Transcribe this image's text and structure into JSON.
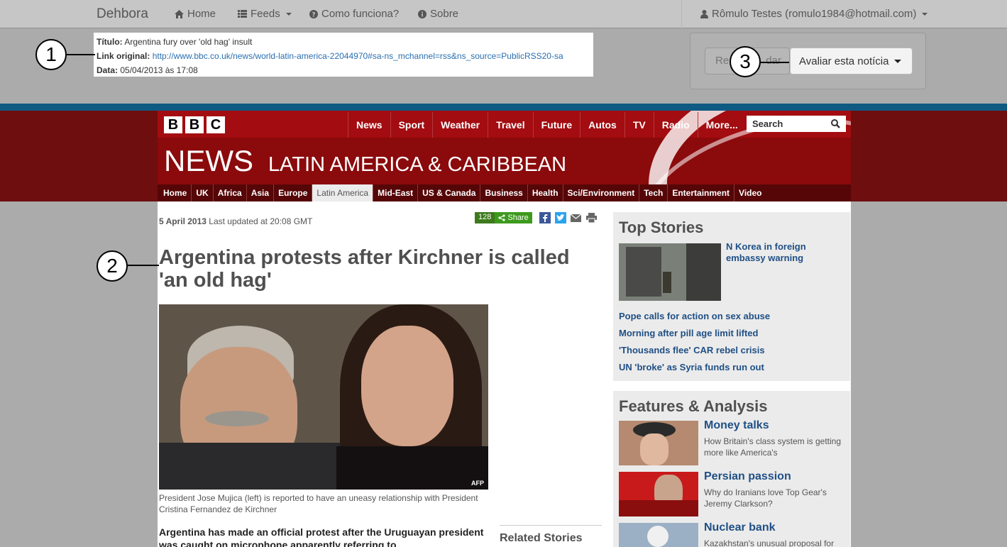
{
  "app": {
    "brand": "Dehbora",
    "nav": [
      {
        "label": "Home",
        "icon": "home-icon"
      },
      {
        "label": "Feeds",
        "icon": "list-icon",
        "dropdown": true
      },
      {
        "label": "Como funciona?",
        "icon": "question-icon"
      },
      {
        "label": "Sobre",
        "icon": "info-icon"
      }
    ],
    "user": "Rômulo Testes (romulo1984@hotmail.com)"
  },
  "meta": {
    "title_label": "Título:",
    "title_value": "Argentina fury over 'old hag' insult",
    "link_label": "Link original:",
    "link_value": "http://www.bbc.co.uk/news/world-latin-america-22044970#sa-ns_mchannel=rss&ns_source=PublicRSS20-sa",
    "date_label": "Data:",
    "date_value": "05/04/2013 às 17:08"
  },
  "rating": {
    "read_label": "Re",
    "read_label_tail": "dar",
    "rate_label": "Avaliar esta notícia"
  },
  "callouts": [
    "1",
    "2",
    "3"
  ],
  "bbc": {
    "logo_letters": [
      "B",
      "B",
      "C"
    ],
    "topnav": [
      "News",
      "Sport",
      "Weather",
      "Travel",
      "Future",
      "Autos",
      "TV",
      "Radio",
      "More..."
    ],
    "search_label": "Search",
    "news_word": "NEWS",
    "region": "LATIN AMERICA & CARIBBEAN",
    "subnav": [
      "Home",
      "UK",
      "Africa",
      "Asia",
      "Europe",
      "Latin America",
      "Mid-East",
      "US & Canada",
      "Business",
      "Health",
      "Sci/Environment",
      "Tech",
      "Entertainment",
      "Video"
    ],
    "subnav_active": "Latin America"
  },
  "article": {
    "date": "5 April 2013",
    "updated": "Last updated at 20:08 GMT",
    "share_count": "128",
    "share_label": "Share",
    "headline": "Argentina protests after Kirchner is called 'an old hag'",
    "photo_credit": "AFP",
    "caption": "President Jose Mujica (left) is reported to have an uneasy relationship with President Cristina Fernandez de Kirchner",
    "lead": "Argentina has made an official protest after the Uruguayan president was caught on microphone apparently referring to",
    "related_title": "Related Stories"
  },
  "top_stories": {
    "title": "Top Stories",
    "first": "N Korea in foreign embassy warning",
    "links": [
      "Pope calls for action on sex abuse",
      "Morning after pill age limit lifted",
      "'Thousands flee' CAR rebel crisis",
      "UN 'broke' as Syria funds run out"
    ]
  },
  "features": {
    "title": "Features & Analysis",
    "items": [
      {
        "title": "Money talks",
        "desc": "How Britain's class system is getting more like America's"
      },
      {
        "title": "Persian passion",
        "desc": "Why do Iranians love Top Gear's Jeremy Clarkson?"
      },
      {
        "title": "Nuclear bank",
        "desc": "Kazakhstan's unusual proposal for"
      }
    ]
  }
}
